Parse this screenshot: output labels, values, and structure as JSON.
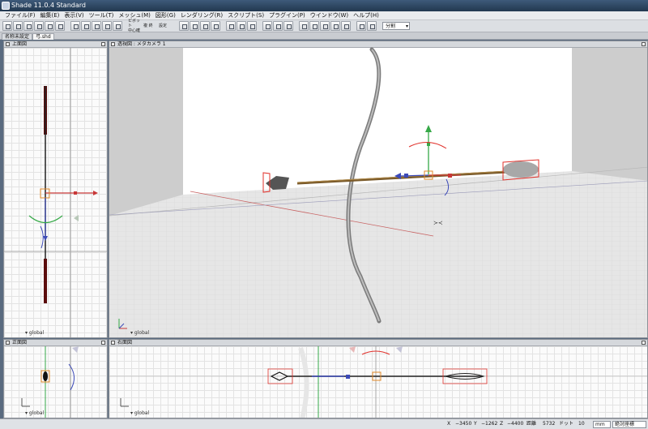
{
  "window": {
    "title": "Shade 11.0.4 Standard"
  },
  "menu": [
    "ファイル(F)",
    "編集(E)",
    "表示(V)",
    "ツール(T)",
    "メッシュ(M)",
    "図形(G)",
    "レンダリング(R)",
    "スクリプト(S)",
    "プラグイン(P)",
    "ウインドウ(W)",
    "ヘルプ(H)"
  ],
  "toolbar": {
    "pivot_label": "ピボット",
    "pivot_sub": "中心確",
    "copy_label": "複 終",
    "set_label": "設定",
    "mode_select": "分割"
  },
  "tabs": [
    "名称未設定",
    "弓.shd"
  ],
  "panes": {
    "top": {
      "title": "上面図",
      "global": "global"
    },
    "perspective": {
      "title": "透視図 : メタカメラ 1",
      "global": "global"
    },
    "front": {
      "title": "正面図",
      "global": "global"
    },
    "right": {
      "title": "右面図",
      "global": "global"
    }
  },
  "status": {
    "x_label": "X",
    "x_value": "−3450",
    "y_label": "Y",
    "y_value": "−1262",
    "z_label": "Z",
    "z_value": "−4400",
    "dist_label": "距離",
    "dist_value": "5732",
    "dot_label": "ドット",
    "dot_value": "10",
    "unit": "mm",
    "coord_mode": "絶対座標"
  },
  "colors": {
    "bow": "#5b5b5b",
    "selection": "#e0302a",
    "handle_x": "#c83838",
    "handle_y": "#36a948",
    "handle_z": "#3c4ab8",
    "axis_red": "#c04040"
  }
}
